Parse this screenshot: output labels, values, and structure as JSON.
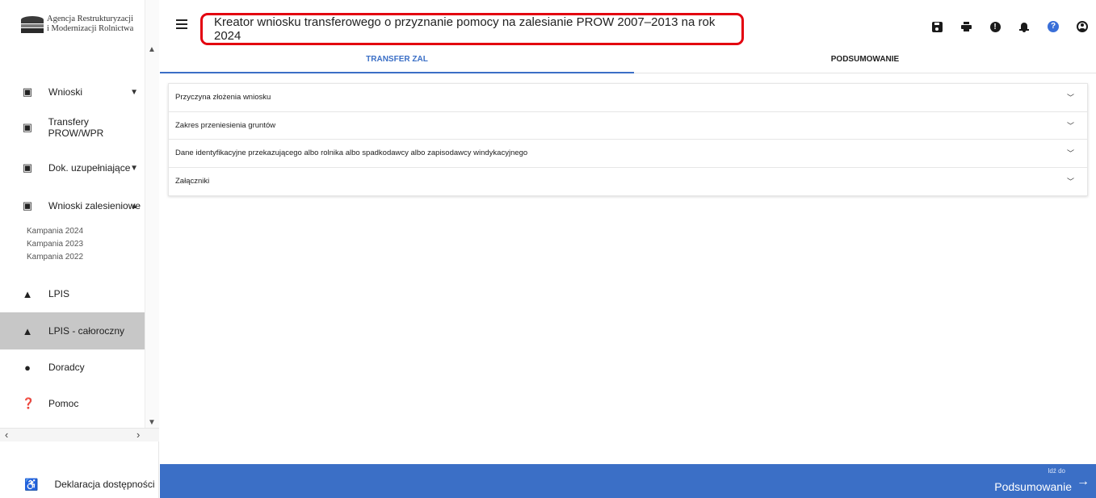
{
  "brand": {
    "line1": "Agencja Restrukturyzacji",
    "line2": "i Modernizacji Rolnictwa"
  },
  "header": {
    "title": "Kreator wniosku transferowego o przyznanie pomocy na zalesianie PROW 2007–2013 na rok 2024",
    "title_outline_color": "#e3000f",
    "icons": [
      "save-icon",
      "print-icon",
      "alert-icon",
      "bell-icon",
      "help-icon",
      "account-icon"
    ]
  },
  "sidebar": {
    "items": [
      {
        "label": "Wnioski",
        "icon": "clipboard-icon",
        "chevron": "down"
      },
      {
        "label": "Transfery PROW/WPR",
        "icon": "clipboard-icon"
      },
      {
        "label": "Dok. uzupełniające",
        "icon": "clipboard-icon",
        "chevron": "down"
      },
      {
        "label": "Wnioski zalesieniowe",
        "icon": "clipboard-icon",
        "chevron": "up"
      },
      {
        "label": "LPIS",
        "icon": "terrain-icon"
      },
      {
        "label": "LPIS - całoroczny",
        "icon": "terrain-icon",
        "active": true
      },
      {
        "label": "Doradcy",
        "icon": "person-icon"
      },
      {
        "label": "Pomoc",
        "icon": "help-circle-icon"
      }
    ],
    "subitems": [
      "Kampania 2024",
      "Kampania 2023",
      "Kampania 2022"
    ],
    "accessibility": {
      "label": "Deklaracja dostępności",
      "icon": "accessibility-icon"
    },
    "active_bg": "#c7c7c7"
  },
  "tabs": [
    {
      "label": "TRANSFER ZAL",
      "active": true
    },
    {
      "label": "PODSUMOWANIE",
      "active": false
    }
  ],
  "sections": [
    {
      "label": "Przyczyna złożenia wniosku"
    },
    {
      "label": "Zakres przeniesienia gruntów"
    },
    {
      "label": "Dane identyfikacyjne przekazującego albo rolnika albo spadkodawcy albo zapisodawcy windykacyjnego"
    },
    {
      "label": "Załączniki"
    }
  ],
  "footer": {
    "small_label": "Idź do",
    "big_label": "Podsumowanie",
    "color": "#3b6fc6"
  }
}
